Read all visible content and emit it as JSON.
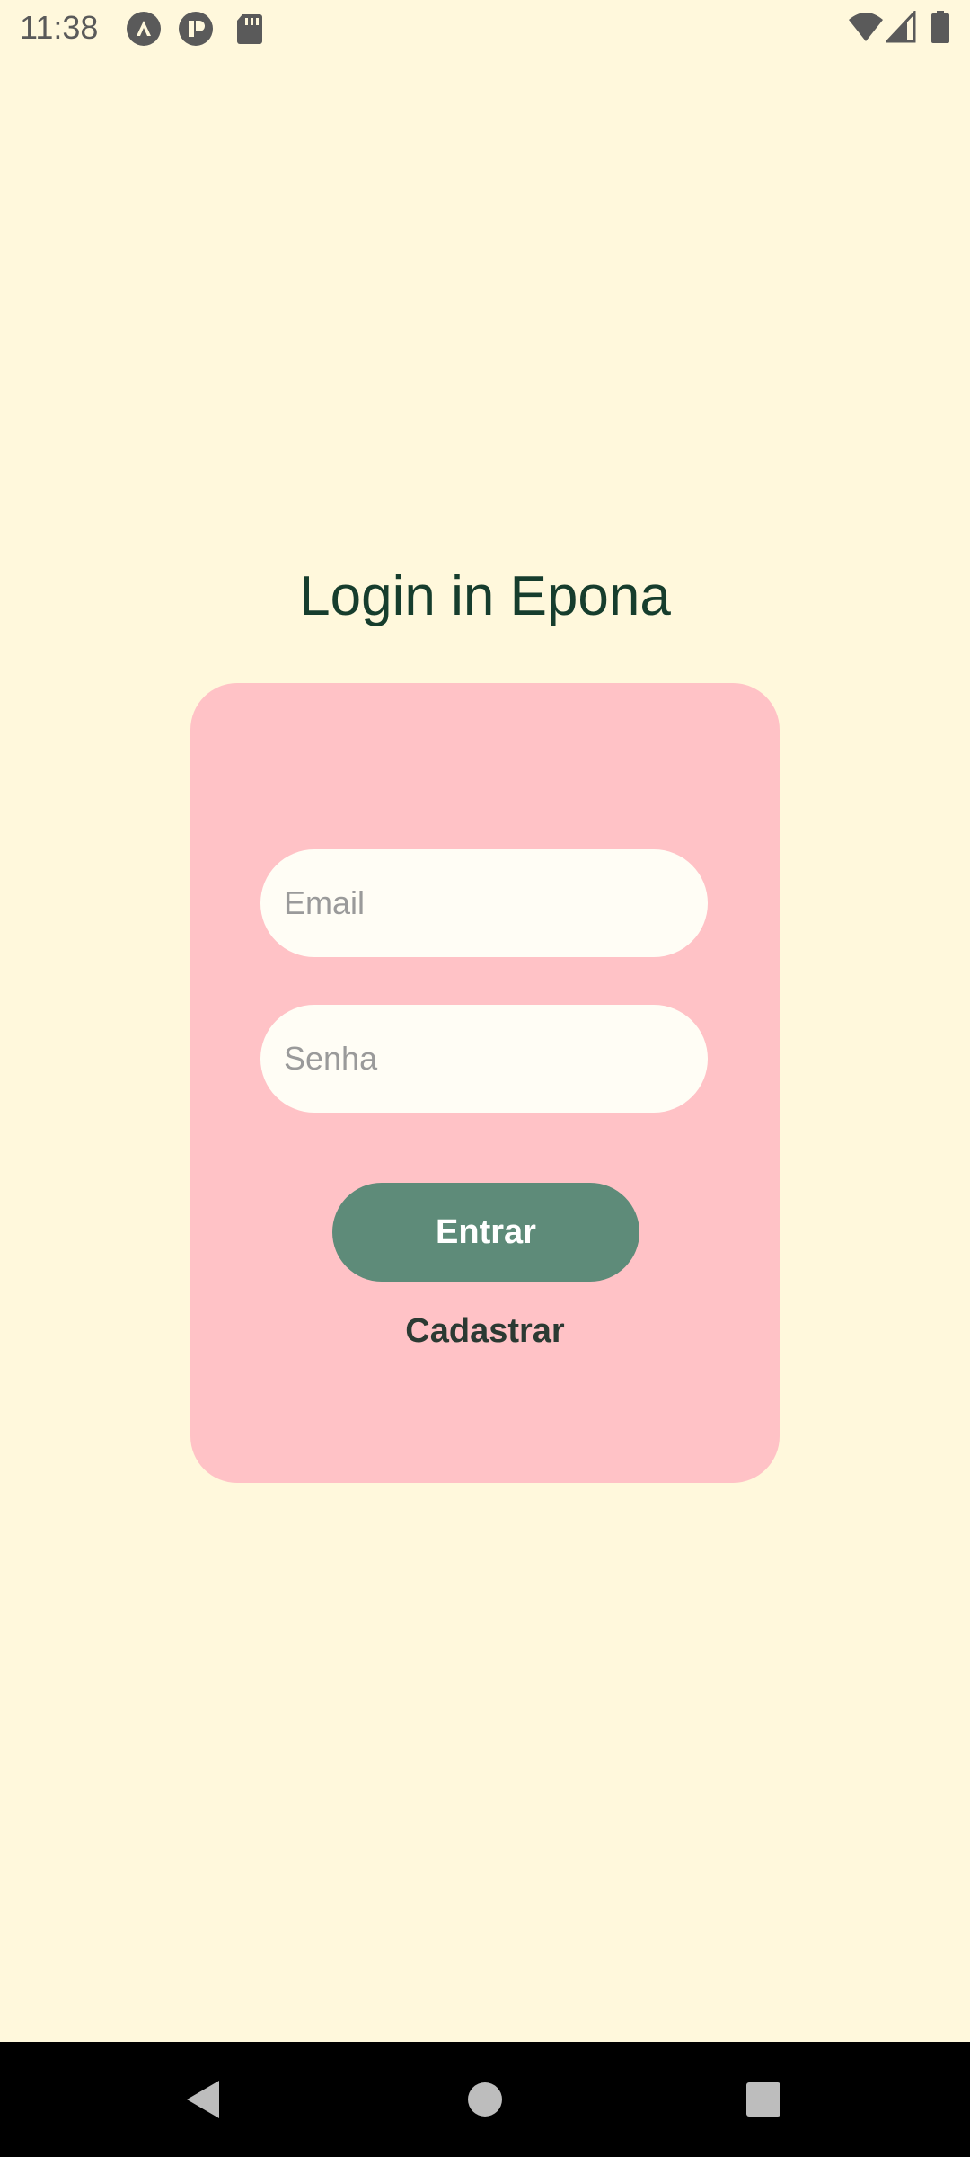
{
  "status_bar": {
    "time": "11:38",
    "left_icons": [
      "app-a-icon",
      "app-p-icon",
      "sd-card-icon"
    ],
    "right_icons": [
      "wifi-icon",
      "cell-signal-icon",
      "battery-icon"
    ]
  },
  "login": {
    "title": "Login in Epona",
    "email_placeholder": "Email",
    "password_placeholder": "Senha",
    "submit_label": "Entrar",
    "register_label": "Cadastrar"
  },
  "navigation": {
    "buttons": [
      "back-icon",
      "home-icon",
      "recents-icon"
    ]
  },
  "colors": {
    "background": "#FFF8DC",
    "card": "#FFC2C6",
    "input": "#FFFDF5",
    "button": "#5E8B79",
    "title": "#163D2D"
  }
}
